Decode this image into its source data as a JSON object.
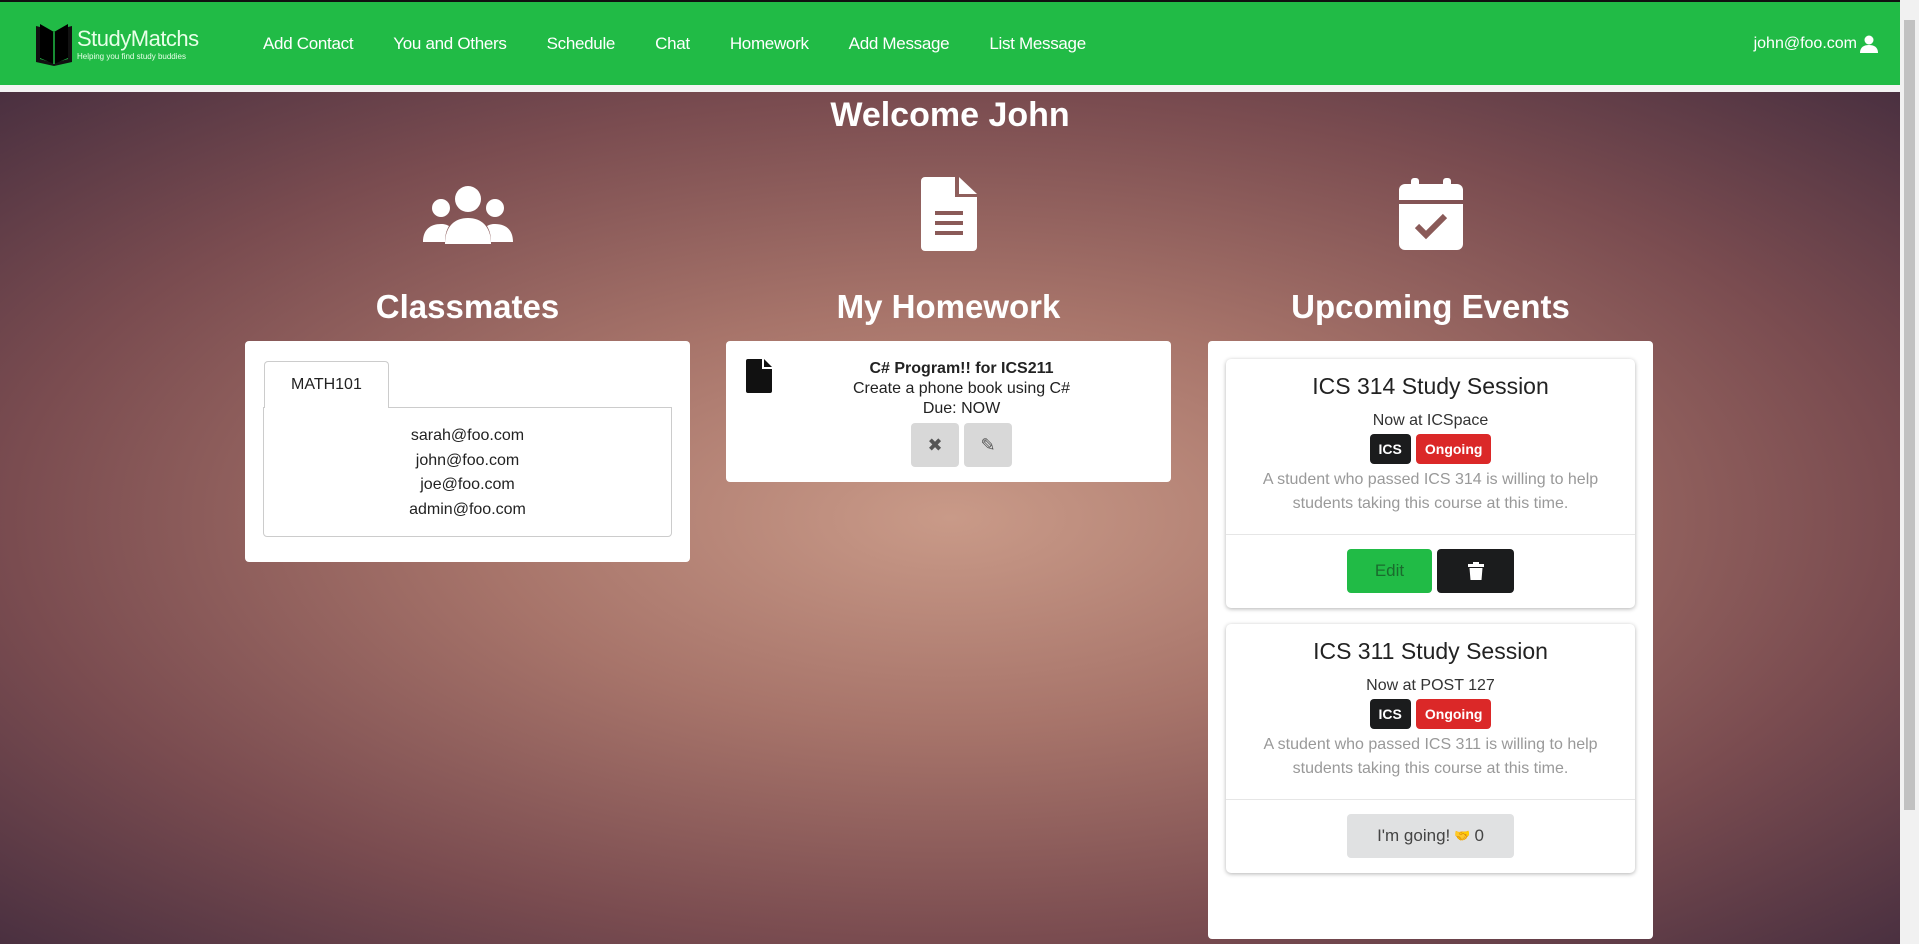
{
  "nav": {
    "brand": "StudyMatchs",
    "tagline": "Helping you find study buddies",
    "links": [
      "Add Contact",
      "You and Others",
      "Schedule",
      "Chat",
      "Homework",
      "Add Message",
      "List Message"
    ],
    "user": "john@foo.com"
  },
  "welcome": "Welcome John",
  "classmates": {
    "title": "Classmates",
    "tab": "MATH101",
    "emails": [
      "sarah@foo.com",
      "john@foo.com",
      "joe@foo.com",
      "admin@foo.com"
    ]
  },
  "homework": {
    "title": "My Homework",
    "item": {
      "title": "C# Program!! for ICS211",
      "description": "Create a phone book using C#",
      "due": "Due: NOW"
    }
  },
  "events": {
    "title": "Upcoming Events",
    "items": [
      {
        "title": "ICS 314 Study Session",
        "location": "Now at ICSpace",
        "tag": "ICS",
        "status": "Ongoing",
        "description": "A student who passed ICS 314 is willing to help students taking this course at this time.",
        "edit": "Edit"
      },
      {
        "title": "ICS 311 Study Session",
        "location": "Now at POST 127",
        "tag": "ICS",
        "status": "Ongoing",
        "description": "A student who passed ICS 311 is willing to help students taking this course at this time.",
        "going": "I'm going!",
        "count": "0"
      }
    ]
  },
  "colors": {
    "brand": "#21bb46",
    "danger": "#db2828",
    "dark": "#1b1c1d"
  }
}
